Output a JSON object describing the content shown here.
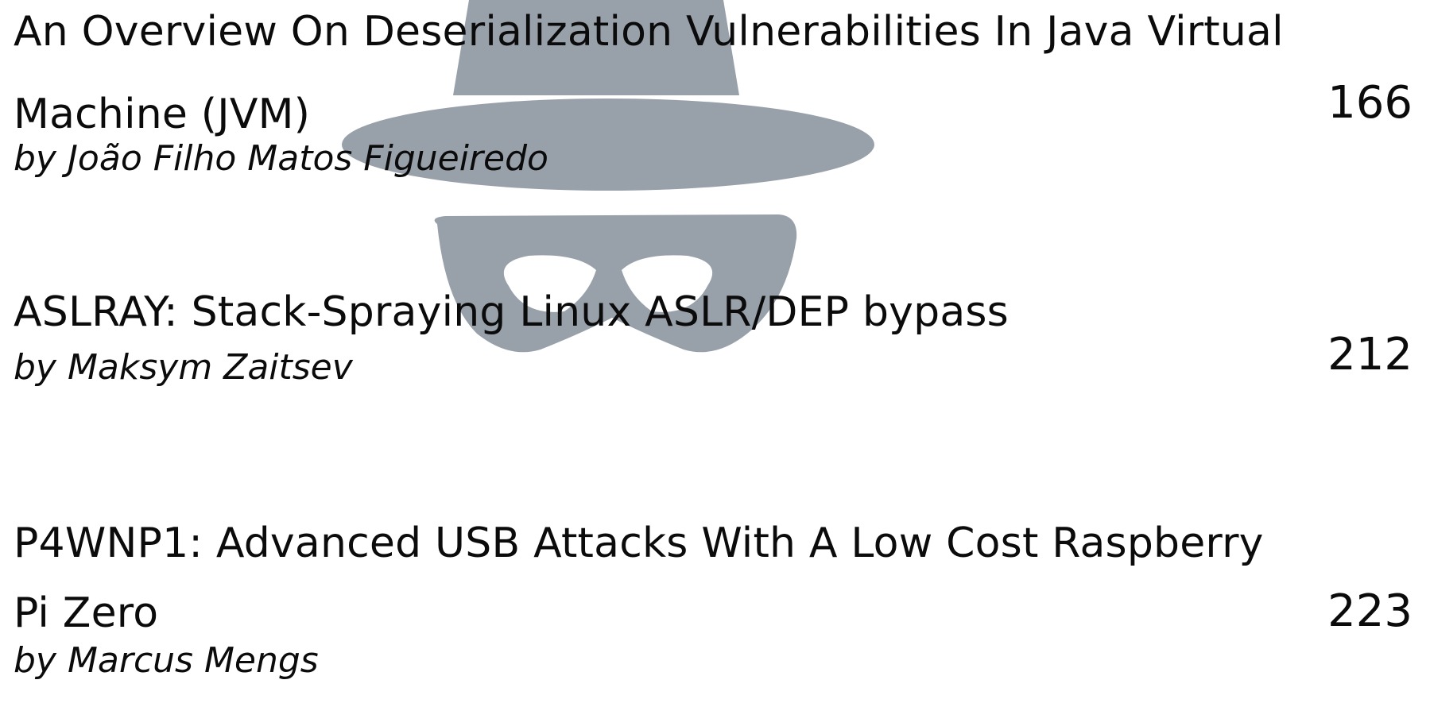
{
  "watermark": {
    "icon": "spy-hat-mask-icon",
    "color": "#98a0aa"
  },
  "entries": [
    {
      "title": "An Overview On Deserialization Vulnerabilities In Java Virtual Machine (JVM)",
      "author": "by João Filho Matos Figueiredo",
      "page": "166"
    },
    {
      "title": "ASLRAY: Stack-Spraying Linux ASLR/DEP bypass",
      "author": "by Maksym Zaitsev",
      "page": "212"
    },
    {
      "title": "P4WNP1: Advanced USB Attacks With A Low Cost Raspberry Pi Zero",
      "author": "by Marcus Mengs",
      "page": "223"
    }
  ]
}
